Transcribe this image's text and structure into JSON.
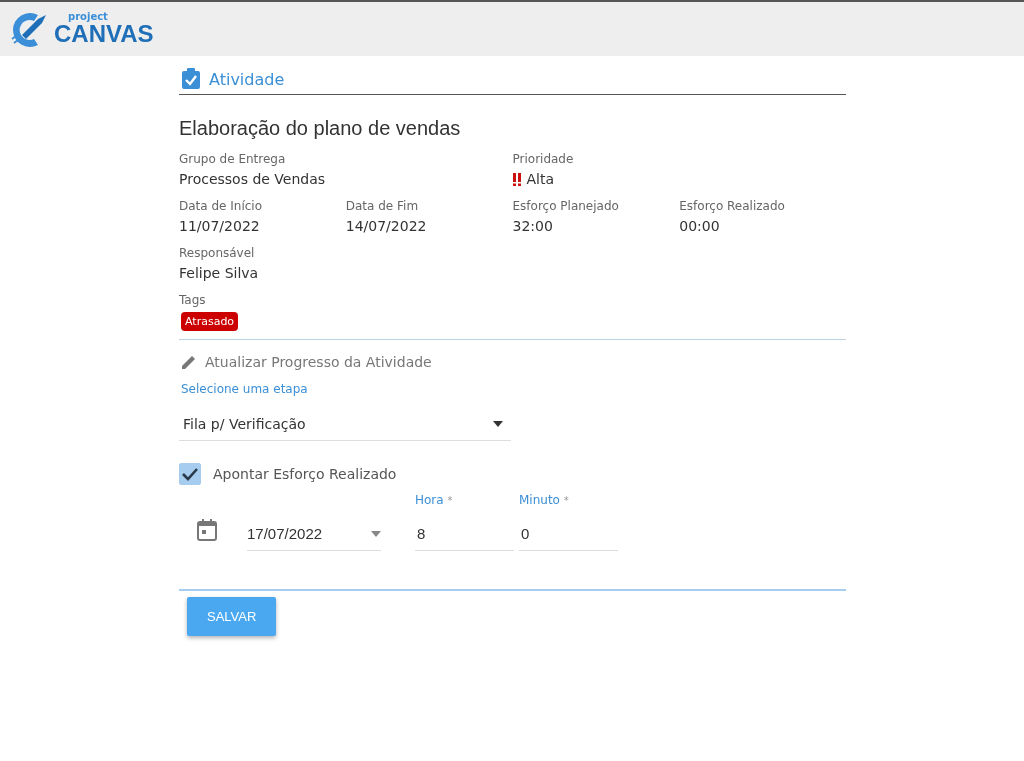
{
  "header": {
    "logo_small": "project",
    "logo_large": "CANVAS"
  },
  "section_title": "Atividade",
  "activity_title": "Elaboração do plano de vendas",
  "detail_rows": [
    [
      {
        "label": "Grupo de Entrega",
        "value": "Processos de Vendas",
        "kind": "text"
      },
      {
        "label": "Prioridade",
        "value": "Alta",
        "kind": "priority"
      }
    ],
    [
      {
        "label": "Data de Início",
        "value": "11/07/2022",
        "kind": "text"
      },
      {
        "label": "Data de Fim",
        "value": "14/07/2022",
        "kind": "text"
      },
      {
        "label": "Esforço Planejado",
        "value": "32:00",
        "kind": "text"
      },
      {
        "label": "Esforço Realizado",
        "value": "00:00",
        "kind": "text"
      }
    ],
    [
      {
        "label": "Responsável",
        "value": "Felipe Silva",
        "kind": "text"
      }
    ]
  ],
  "tags": {
    "label": "Tags",
    "items": [
      {
        "text": "Atrasado",
        "color": "#cc0000"
      }
    ]
  },
  "progress": {
    "title": "Atualizar Progresso da Atividade",
    "stage_label": "Selecione uma etapa",
    "stage_value": "Fila p/ Verificação",
    "effort_checkbox": {
      "label": "Apontar Esforço Realizado",
      "checked": true
    },
    "date_value": "17/07/2022",
    "hour": {
      "label": "Hora",
      "required": "*",
      "value": "8"
    },
    "minute": {
      "label": "Minuto",
      "required": "*",
      "value": "0"
    }
  },
  "save_button": "SALVAR"
}
